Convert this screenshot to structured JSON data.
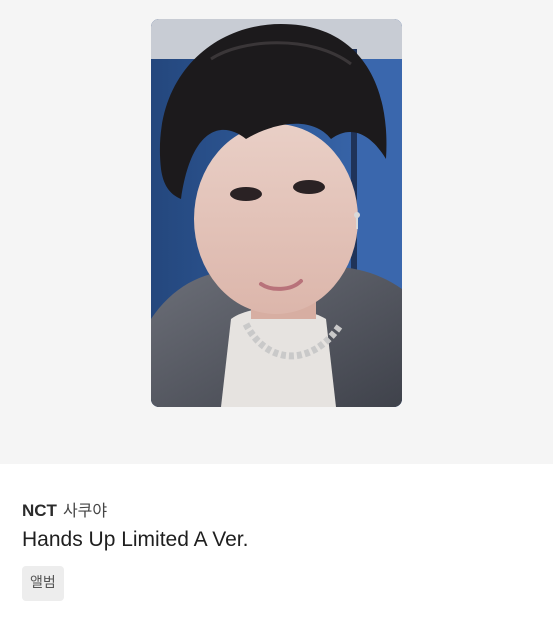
{
  "listing": {
    "artist": "NCT",
    "member": "사쿠야",
    "album": "Hands Up Limited A Ver.",
    "tag": "앨범"
  },
  "colors": {
    "image_background": "#f5f5f5",
    "tag_background": "#ededed"
  }
}
